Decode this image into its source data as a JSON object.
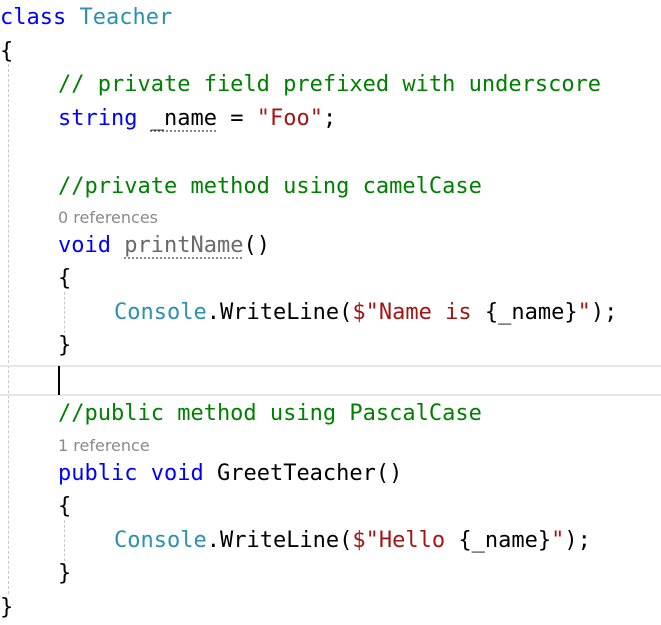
{
  "editor": {
    "class_decl": {
      "keyword": "class",
      "name": "Teacher"
    },
    "brace_open": "{",
    "brace_close": "}",
    "field_comment": "// private field prefixed with underscore",
    "field": {
      "type": "string",
      "name": "_name",
      "equals": " = ",
      "value": "\"Foo\"",
      "semicolon": ";"
    },
    "private_method": {
      "comment": "//private method using camelCase",
      "codelens": "0 references",
      "return_type": "void",
      "name": "printName",
      "parens": "()",
      "open": "{",
      "close": "}",
      "body": {
        "class_ref": "Console",
        "call": ".WriteLine(",
        "interp_prefix": "$",
        "text": "\"Name is ",
        "interp": "{_name}",
        "quote_end": "\"",
        "end": ");"
      }
    },
    "public_method": {
      "comment": "//public method using PascalCase",
      "codelens": "1 reference",
      "modifier": "public",
      "return_type": "void",
      "name": "GreetTeacher",
      "parens": "()",
      "open": "{",
      "close": "}",
      "body": {
        "class_ref": "Console",
        "call": ".WriteLine(",
        "interp_prefix": "$",
        "text": "\"Hello ",
        "interp": "{_name}",
        "quote_end": "\"",
        "end": ");"
      }
    },
    "colors": {
      "keyword": "#0000ff",
      "type": "#2b91af",
      "comment": "#008000",
      "string": "#a31515",
      "codelens": "#8a8a8a"
    }
  }
}
